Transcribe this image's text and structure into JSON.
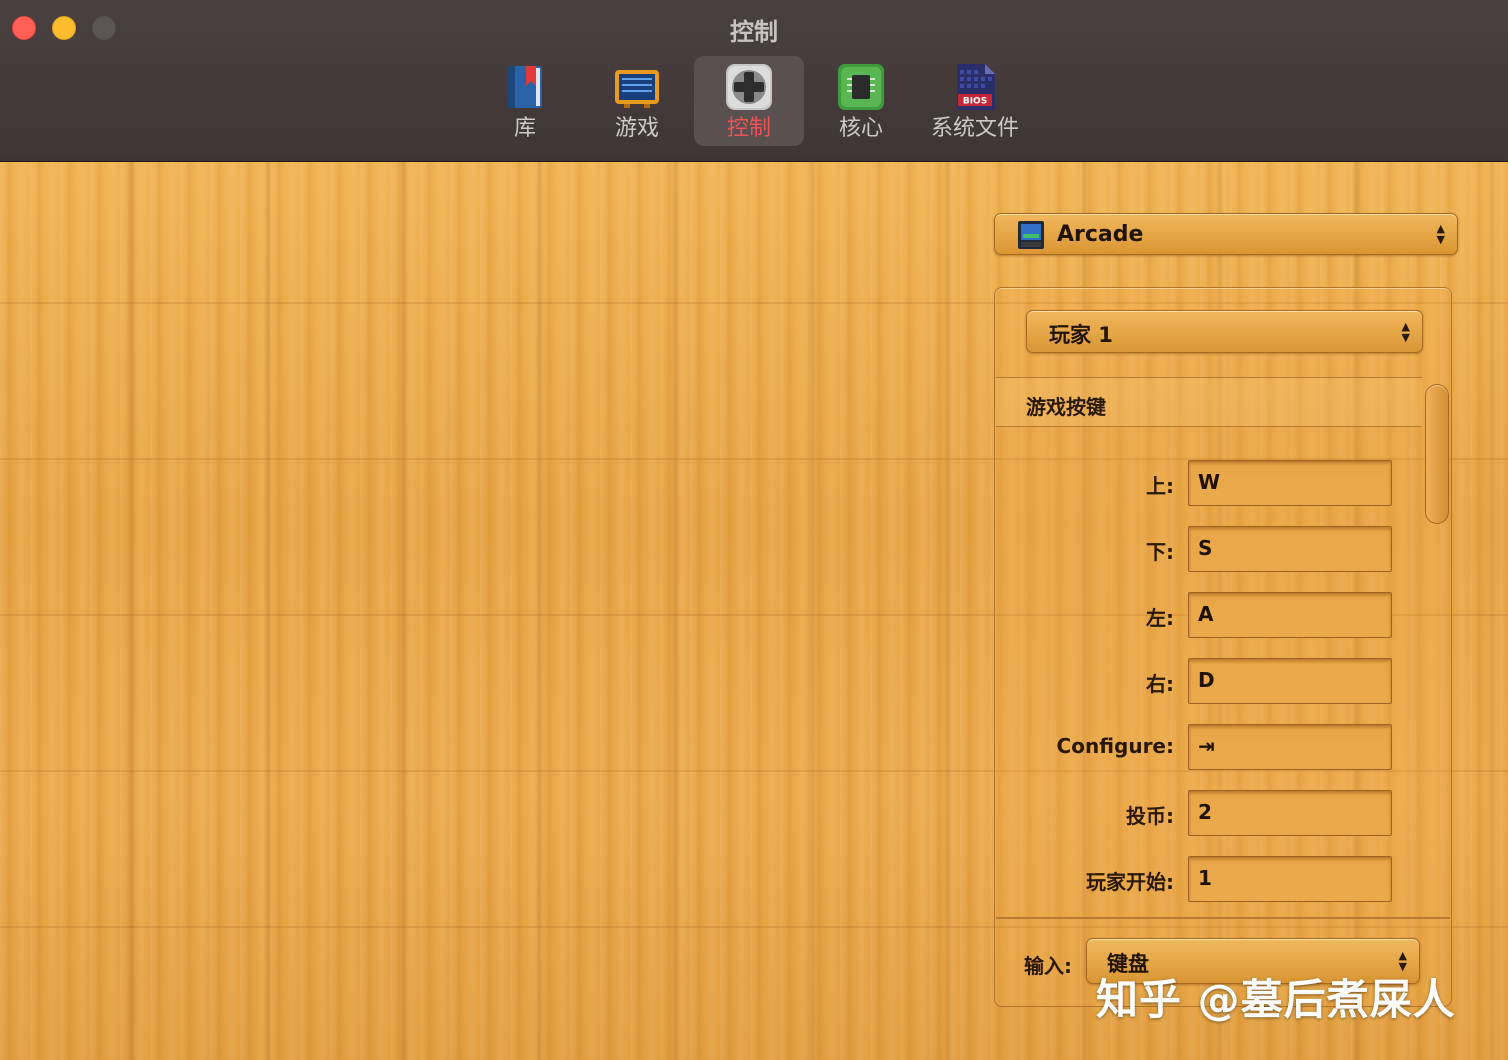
{
  "window": {
    "title": "控制"
  },
  "toolbar": {
    "items": [
      {
        "label": "库",
        "icon": "library-book-icon"
      },
      {
        "label": "游戏",
        "icon": "arcade-screen-icon"
      },
      {
        "label": "控制",
        "icon": "gamepad-icon",
        "active": true
      },
      {
        "label": "核心",
        "icon": "chip-icon"
      },
      {
        "label": "系统文件",
        "icon": "bios-file-icon",
        "badge": "BIOS"
      }
    ]
  },
  "system_select": {
    "value": "Arcade",
    "icon": "arcade-cabinet-icon"
  },
  "player_select": {
    "value": "玩家 1"
  },
  "section": {
    "title": "游戏按键"
  },
  "bindings": [
    {
      "label": "上:",
      "value": "W"
    },
    {
      "label": "下:",
      "value": "S"
    },
    {
      "label": "左:",
      "value": "A"
    },
    {
      "label": "右:",
      "value": "D"
    },
    {
      "label": "Configure:",
      "value": "⇥"
    },
    {
      "label": "投币:",
      "value": "2"
    },
    {
      "label": "玩家开始:",
      "value": "1"
    }
  ],
  "input": {
    "label": "输入:",
    "value": "键盘"
  },
  "watermark": "知乎 @墓后煮屎人",
  "colors": {
    "accent_active": "#f05356",
    "wood": "#e9a847",
    "titlebar": "#443a3a"
  }
}
